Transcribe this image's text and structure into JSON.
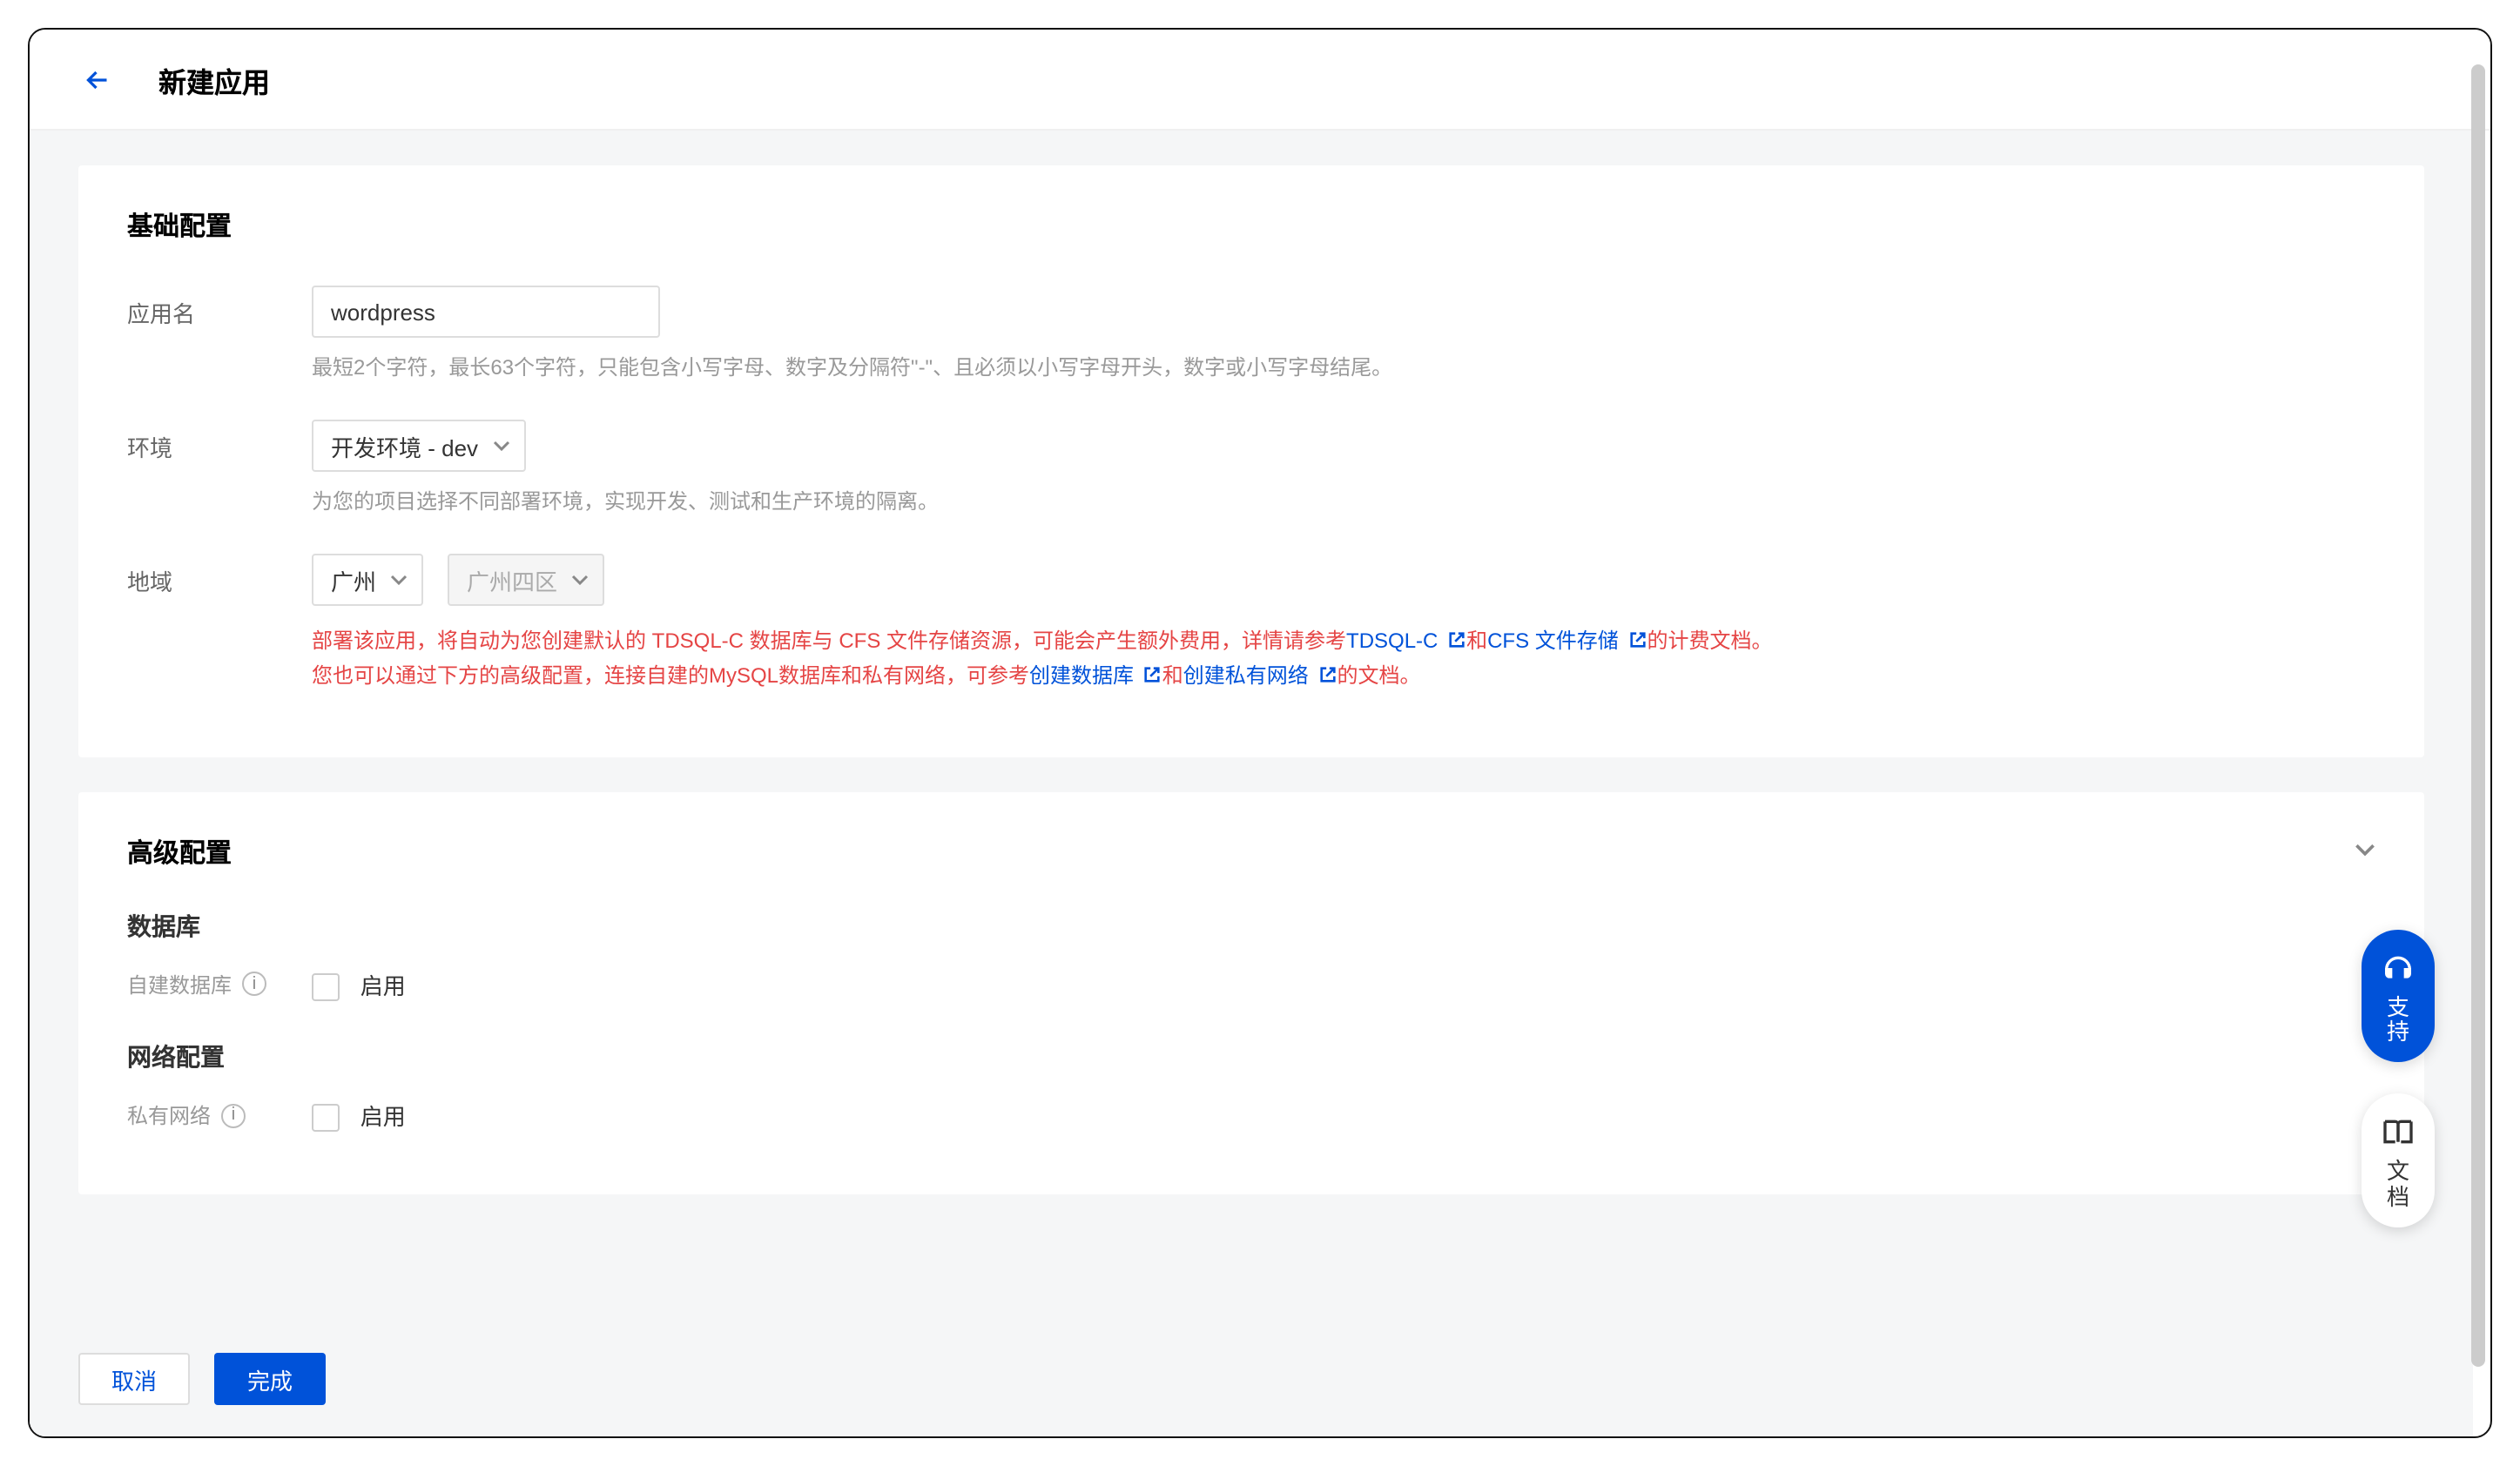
{
  "header": {
    "title": "新建应用"
  },
  "basic": {
    "title": "基础配置",
    "fields": {
      "appName": {
        "label": "应用名",
        "value": "wordpress",
        "helper": "最短2个字符，最长63个字符，只能包含小写字母、数字及分隔符\"-\"、且必须以小写字母开头，数字或小写字母结尾。"
      },
      "environment": {
        "label": "环境",
        "selected": "开发环境 - dev",
        "helper": "为您的项目选择不同部署环境，实现开发、测试和生产环境的隔离。"
      },
      "region": {
        "label": "地域",
        "region": "广州",
        "zone": "广州四区",
        "warn": {
          "line1": {
            "p1": "部署该应用，将自动为您创建默认的 TDSQL-C 数据库与 CFS 文件存储资源，可能会产生额外费用，详情请参考",
            "link1": "TDSQL-C ",
            "p2": "和",
            "link2": "CFS 文件存储 ",
            "p3": "的计费文档。"
          },
          "line2": {
            "p1": "您也可以通过下方的高级配置，连接自建的MySQL数据库和私有网络，可参考",
            "link1": "创建数据库 ",
            "p2": "和",
            "link2": "创建私有网络 ",
            "p3": "的文档。"
          }
        }
      }
    }
  },
  "advanced": {
    "title": "高级配置",
    "db": {
      "title": "数据库",
      "customDb": {
        "label": "自建数据库",
        "checkbox": "启用"
      }
    },
    "network": {
      "title": "网络配置",
      "vpc": {
        "label": "私有网络",
        "checkbox": "启用"
      }
    }
  },
  "footer": {
    "cancel": "取消",
    "finish": "完成"
  },
  "float": {
    "support": [
      "支",
      "持"
    ],
    "docs": [
      "文",
      "档"
    ]
  }
}
